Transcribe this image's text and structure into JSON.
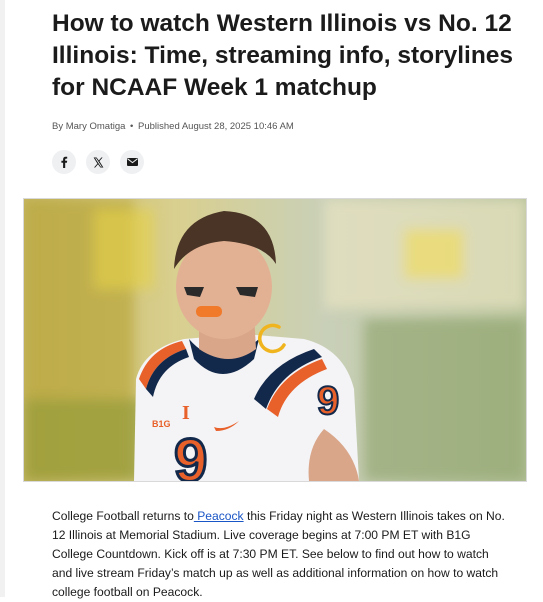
{
  "article": {
    "title": "How to watch Western Illinois vs No. 12 Illinois: Time, streaming info, storylines for NCAAF Week 1 matchup",
    "byline_prefix": "By",
    "author": "Mary Omatiga",
    "separator": "•",
    "published": "Published August 28, 2025 10:46 AM"
  },
  "share": {
    "facebook_icon": "f",
    "x_icon": "𝕏",
    "email_icon": "email-icon"
  },
  "hero": {
    "jersey_sleeve_number": "9",
    "jersey_front_number": "9",
    "helmet_logo_letter": "I",
    "sleeve_logo": "B1G"
  },
  "body": {
    "p1_before_link": "College Football returns to",
    "p1_link": " Peacock",
    "p1_after_link": " this Friday night as Western Illinois takes on No. 12 Illinois at Memorial Stadium. Live coverage begins at 7:00 PM ET with B1G College Countdown. Kick off is at 7:30 PM ET. See below to find out how to watch and live stream Friday’s match up as well as additional information on how to watch college football on Peacock."
  },
  "colors": {
    "link": "#1a55c6",
    "illinois_orange": "#e8602a",
    "illinois_navy": "#13294b"
  }
}
